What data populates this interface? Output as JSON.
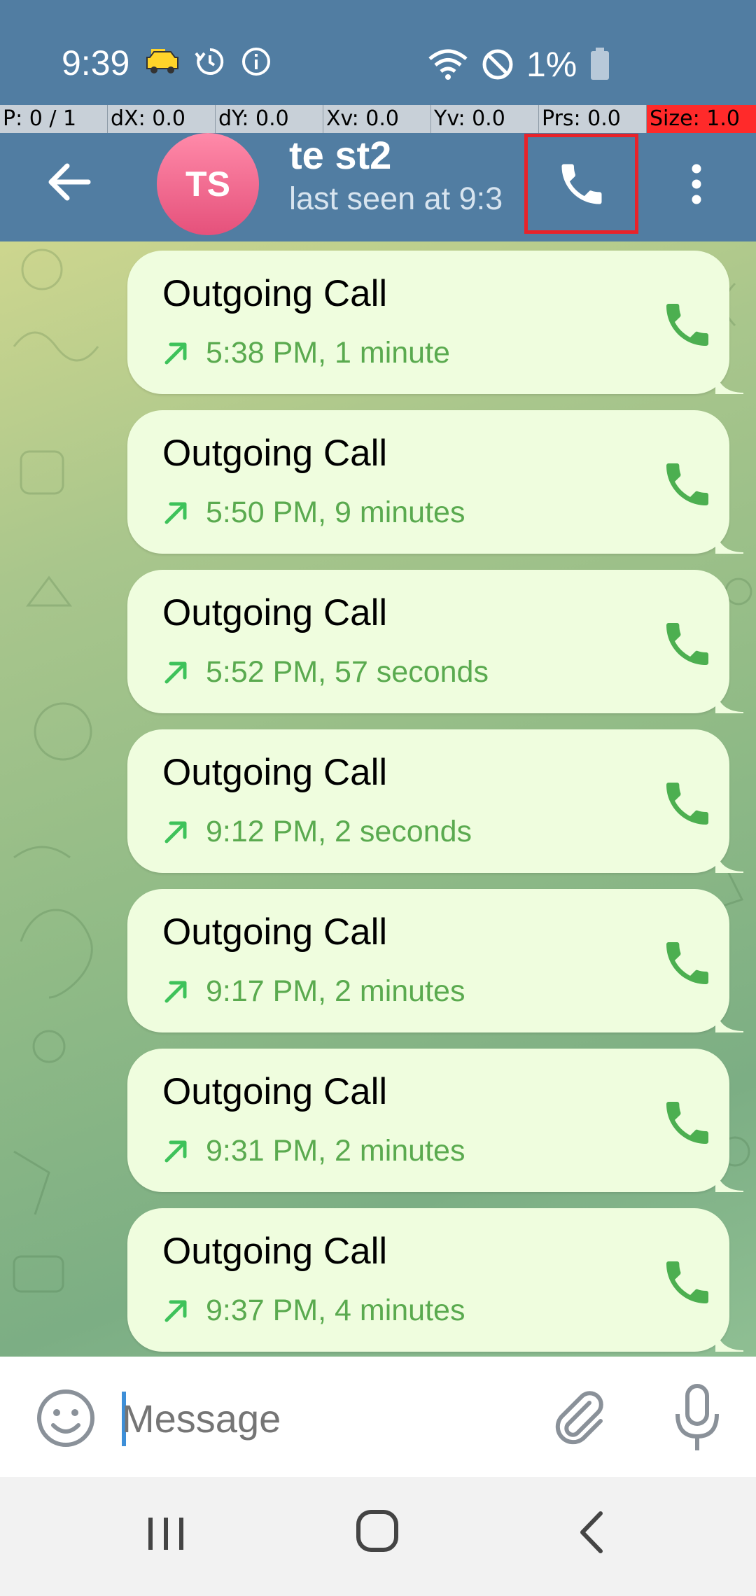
{
  "status_bar": {
    "time": "9:39",
    "battery_text": "1%"
  },
  "debug_overlay": {
    "cells": [
      "P: 0 / 1",
      "dX: 0.0",
      "dY: 0.0",
      "Xv: 0.0",
      "Yv: 0.0",
      "Prs: 0.0",
      "Size: 1.0"
    ]
  },
  "header": {
    "avatar_initials": "TS",
    "contact_name": "te st2",
    "contact_status": "last seen at 9:3",
    "back_icon": "arrow-left-icon",
    "call_icon": "phone-icon",
    "more_icon": "more-vertical-icon"
  },
  "messages": [
    {
      "title": "Outgoing Call",
      "detail": "5:38 PM, 1 minute"
    },
    {
      "title": "Outgoing Call",
      "detail": "5:50 PM, 9 minutes"
    },
    {
      "title": "Outgoing Call",
      "detail": "5:52 PM, 57 seconds"
    },
    {
      "title": "Outgoing Call",
      "detail": "9:12 PM, 2 seconds"
    },
    {
      "title": "Outgoing Call",
      "detail": "9:17 PM, 2 minutes"
    },
    {
      "title": "Outgoing Call",
      "detail": "9:31 PM, 2 minutes"
    },
    {
      "title": "Outgoing Call",
      "detail": "9:37 PM, 4 minutes"
    }
  ],
  "composer": {
    "placeholder": "Message"
  },
  "colors": {
    "header": "#517da2",
    "bubble": "#effdde",
    "call_green": "#5aaa4f",
    "highlight": "#e8222a"
  }
}
